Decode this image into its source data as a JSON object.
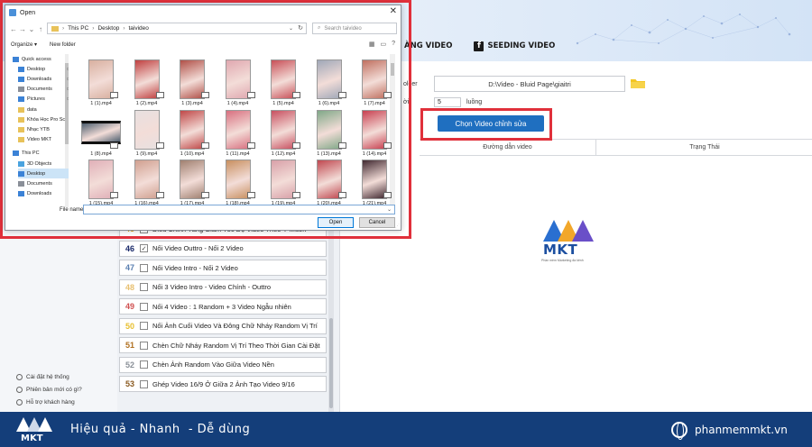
{
  "app": {
    "tabs": [
      {
        "label": "ÀNG VIDEO"
      },
      {
        "label": "SEEDING VIDEO"
      }
    ],
    "folder_label": "older",
    "time_label": "ời",
    "path_value": "D:\\Video - Bluid Page\\giaitri",
    "time_value": "5",
    "time_unit": "luồng",
    "choose_button": "Chọn Video chỉnh sửa",
    "table_headers": {
      "path": "Đường dẫn video",
      "state": "Trạng Thái"
    },
    "features": [
      {
        "num": "45",
        "label": "Điều Chỉnh Tăng Giảm Tốc Độ Video Theo Ý Muốn",
        "checked": false,
        "color": "#e0a020"
      },
      {
        "num": "46",
        "label": "Nối Video Outtro - Nối 2 Video",
        "checked": true,
        "color": "#1a2a6a"
      },
      {
        "num": "47",
        "label": "Nối Video Intro - Nối 2 Video",
        "checked": false,
        "color": "#5a7fb0"
      },
      {
        "num": "48",
        "label": "Nối 3 Video Intro - Video Chính - Outtro",
        "checked": false,
        "color": "#e8c070"
      },
      {
        "num": "49",
        "label": "Nối 4 Video : 1 Random  + 3 Video Ngẫu nhiên",
        "checked": false,
        "color": "#d05050"
      },
      {
        "num": "50",
        "label": "Nối Ảnh Cuối Video Và Đông Chữ Nháy Random Vị Trí",
        "checked": false,
        "color": "#e8c030"
      },
      {
        "num": "51",
        "label": "Chèn Chữ Nháy Random Vị Trí Theo Thời Gian Cài Đặt",
        "checked": false,
        "color": "#b07020"
      },
      {
        "num": "52",
        "label": "Chèn Ảnh Random Vào Giữa Video Nền",
        "checked": false,
        "color": "#8a9098"
      },
      {
        "num": "53",
        "label": "Ghép Video 16/9 Ở Giữa 2 Ảnh Tạo Video 9/16",
        "checked": false,
        "color": "#8a5a20"
      }
    ],
    "sidebar_links": [
      {
        "label": "Cài đặt hệ thống",
        "icon": "settings-icon"
      },
      {
        "label": "Phiên bản mới có gì?",
        "icon": "info-icon"
      },
      {
        "label": "Hỗ trợ khách hàng",
        "icon": "support-icon"
      }
    ],
    "brand": {
      "name": "MKT",
      "tagline": "Phần mềm Marketing đa kênh"
    },
    "bottom": {
      "logo": "MKT",
      "slogan": "Hiệu quả - Nhanh  - Dễ dùng",
      "site": "phanmemmkt.vn"
    }
  },
  "dialog": {
    "title": "Open",
    "breadcrumb": [
      "This PC",
      "Desktop",
      "taivideo"
    ],
    "search_placeholder": "Search taivideo",
    "organize": "Organize ▾",
    "new_folder": "New folder",
    "nav_items": [
      {
        "label": "Quick access",
        "icon": "star-icon"
      },
      {
        "label": "Desktop",
        "icon": "desktop-icon",
        "pin": true
      },
      {
        "label": "Downloads",
        "icon": "download-icon",
        "pin": true
      },
      {
        "label": "Documents",
        "icon": "documents-icon",
        "pin": true
      },
      {
        "label": "Pictures",
        "icon": "pictures-icon",
        "pin": true
      },
      {
        "label": "data",
        "icon": "folder-icon"
      },
      {
        "label": "Khóa Học Pro Sc",
        "icon": "folder-icon"
      },
      {
        "label": "Nhạc YTB",
        "icon": "folder-icon"
      },
      {
        "label": "Video MKT",
        "icon": "folder-icon"
      },
      {
        "label": "This PC",
        "icon": "pc-icon"
      },
      {
        "label": "3D Objects",
        "icon": "cube-icon"
      },
      {
        "label": "Desktop",
        "icon": "desktop-icon",
        "selected": true
      },
      {
        "label": "Documents",
        "icon": "documents-icon"
      },
      {
        "label": "Downloads",
        "icon": "download-icon"
      }
    ],
    "files": [
      {
        "name": "1 (1).mp4",
        "color": "#d8b0a0"
      },
      {
        "name": "1 (2).mp4",
        "color": "#c04040"
      },
      {
        "name": "1 (3).mp4",
        "color": "#b05048"
      },
      {
        "name": "1 (4).mp4",
        "color": "#e0a8b0"
      },
      {
        "name": "1 (5).mp4",
        "color": "#c85058"
      },
      {
        "name": "1 (6).mp4",
        "color": "#a0a8b8"
      },
      {
        "name": "1 (7).mp4",
        "color": "#c07060"
      },
      {
        "name": "1 (8).mp4",
        "color": "#506070",
        "wide": true
      },
      {
        "name": "1 (9).mp4",
        "color": "#e8e0e0"
      },
      {
        "name": "1 (10).mp4",
        "color": "#c04848"
      },
      {
        "name": "1 (11).mp4",
        "color": "#d87080"
      },
      {
        "name": "1 (12).mp4",
        "color": "#c85060"
      },
      {
        "name": "1 (13).mp4",
        "color": "#80a888"
      },
      {
        "name": "1 (14).mp4",
        "color": "#c84050"
      },
      {
        "name": "1 (15).mp4",
        "color": "#e0b0b8"
      },
      {
        "name": "1 (16).mp4",
        "color": "#d0a090"
      },
      {
        "name": "1 (17).mp4",
        "color": "#a08070"
      },
      {
        "name": "1 (18).mp4",
        "color": "#c89060"
      },
      {
        "name": "1 (19).mp4",
        "color": "#d8a0a8"
      },
      {
        "name": "1 (20).mp4",
        "color": "#c04850"
      },
      {
        "name": "1 (21).mp4",
        "color": "#402830"
      }
    ],
    "file_name_label": "File name:",
    "file_name_value": "",
    "open_button": "Open",
    "cancel_button": "Cancel"
  },
  "colors": {
    "highlight": "#e0303b",
    "primary_button": "#1f6fc0",
    "bottom_bar": "#143e7a"
  }
}
